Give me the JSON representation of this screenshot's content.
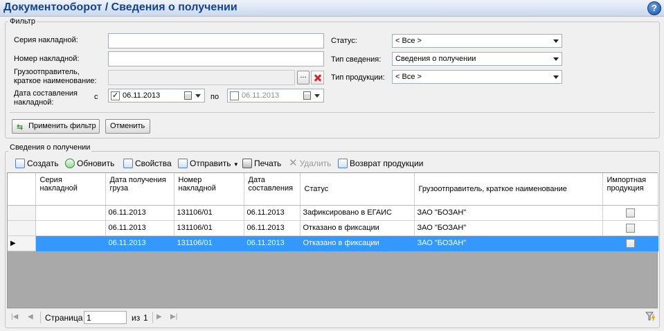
{
  "header": {
    "title": "Документооборот  / Сведения о получении",
    "help_glyph": "?"
  },
  "filter": {
    "legend": "Фильтр",
    "series_label": "Серия накладной:",
    "series_value": "",
    "number_label": "Номер накладной:",
    "number_value": "",
    "shipper_label_1": "Грузоотправитель,",
    "shipper_label_2": "краткое наименование:",
    "shipper_value": "",
    "browse_label": "...",
    "date_label_1": "Дата составления",
    "date_label_2": "накладной:",
    "from_label": "с",
    "from_checked": "✓",
    "from_date": "06.11.2013",
    "to_label": "по",
    "to_date": "06.11.2013",
    "status_label": "Статус:",
    "status_value": "< Все >",
    "info_type_label": "Тип сведения:",
    "info_type_value": "Сведения о получении",
    "product_type_label": "Тип продукции:",
    "product_type_value": "< Все >",
    "apply_label": "Применить фильтр",
    "cancel_label": "Отменить"
  },
  "list": {
    "legend": "Сведения о получении",
    "toolbar": {
      "create": "Создать",
      "refresh": "Обновить",
      "properties": "Свойства",
      "send": "Отправить",
      "print": "Печать",
      "delete": "Удалить",
      "return": "Возврат продукции"
    },
    "columns": {
      "series": "Серия накладной",
      "received": "Дата получения груза",
      "number": "Номер накладной",
      "created": "Дата составления",
      "status": "Статус",
      "shipper": "Грузоотправитель, краткое наименование",
      "imported": "Импортная продукция"
    },
    "rows": [
      {
        "series": "",
        "received": "06.11.2013",
        "number": "131106/01",
        "created": "06.11.2013",
        "status": "Зафиксировано в ЕГАИС",
        "shipper": "ЗАО \"БОЗАН\"",
        "imported": false
      },
      {
        "series": "",
        "received": "06.11.2013",
        "number": "131106/01",
        "created": "06.11.2013",
        "status": "Отказано в фиксации",
        "shipper": "ЗАО \"БОЗАН\"",
        "imported": false
      },
      {
        "series": "",
        "received": "06.11.2013",
        "number": "131106/01",
        "created": "06.11.2013",
        "status": "Отказано в фиксации",
        "shipper": "ЗАО \"БОЗАН\"",
        "imported": false,
        "selected": true
      }
    ],
    "current_row_marker": "▶"
  },
  "pager": {
    "page_label": "Страница",
    "page_value": "1",
    "of_label": "из",
    "total_pages": "1"
  },
  "colors": {
    "title": "#15428b",
    "selection": "#3399ff",
    "grid_empty": "#a9a9a9"
  }
}
